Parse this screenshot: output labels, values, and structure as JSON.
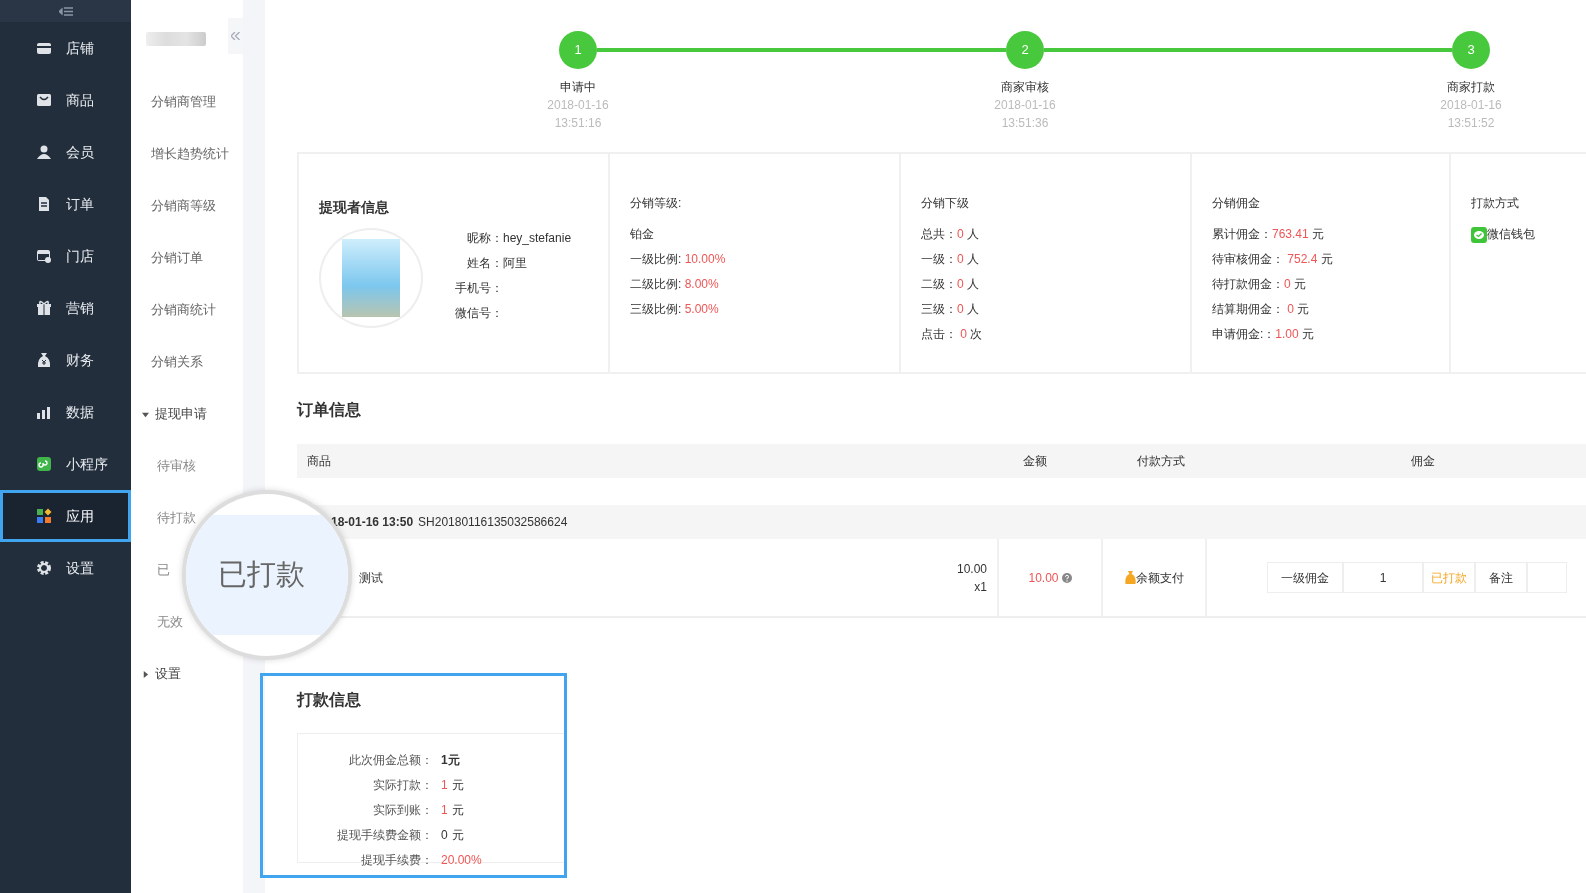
{
  "sidebar": {
    "items": [
      {
        "label": "店铺",
        "selected": false
      },
      {
        "label": "商品",
        "selected": false
      },
      {
        "label": "会员",
        "selected": false
      },
      {
        "label": "订单",
        "selected": false
      },
      {
        "label": "门店",
        "selected": false
      },
      {
        "label": "营销",
        "selected": false
      },
      {
        "label": "财务",
        "selected": false
      },
      {
        "label": "数据",
        "selected": false
      },
      {
        "label": "小程序",
        "selected": false
      },
      {
        "label": "应用",
        "selected": true
      },
      {
        "label": "设置",
        "selected": false
      }
    ]
  },
  "subnav": {
    "items": [
      {
        "label": "分销商管理"
      },
      {
        "label": "增长趋势统计"
      },
      {
        "label": "分销商等级"
      },
      {
        "label": "分销订单"
      },
      {
        "label": "分销商统计"
      },
      {
        "label": "分销关系"
      },
      {
        "label": "提现申请",
        "expanded": true,
        "children": [
          {
            "label": "待审核"
          },
          {
            "label": "待打款"
          },
          {
            "label": "已"
          },
          {
            "label": "无效"
          }
        ]
      },
      {
        "label": "设置",
        "expanded": false
      }
    ]
  },
  "steps": [
    {
      "number": "1",
      "label": "申请中",
      "date": "2018-01-16",
      "time": "13:51:16",
      "done": true
    },
    {
      "number": "2",
      "label": "商家审核",
      "date": "2018-01-16",
      "time": "13:51:36",
      "done": true
    },
    {
      "number": "3",
      "label": "商家打款",
      "date": "2018-01-16",
      "time": "13:51:52",
      "done": true
    }
  ],
  "withdrawer": {
    "title": "提现者信息",
    "fields": [
      {
        "label": "昵称：",
        "value": "hey_stefanie"
      },
      {
        "label": "姓名：",
        "value": "阿里"
      },
      {
        "label": "手机号："
      },
      {
        "label": "微信号："
      }
    ]
  },
  "level": {
    "title": "分销等级:",
    "name": "铂金",
    "rows": [
      {
        "label": "一级比例: ",
        "value": "10.00%"
      },
      {
        "label": "二级比例: ",
        "value": "8.00%"
      },
      {
        "label": "三级比例: ",
        "value": "5.00%"
      }
    ]
  },
  "subordinates": {
    "title": "分销下级",
    "rows": [
      {
        "label": "总共：",
        "value": "0",
        "unit": "人"
      },
      {
        "label": "一级：",
        "value": "0",
        "unit": "人"
      },
      {
        "label": "二级：",
        "value": "0",
        "unit": "人"
      },
      {
        "label": "三级：",
        "value": "0",
        "unit": "人"
      },
      {
        "label": "点击： ",
        "value": "0",
        "unit": "次"
      }
    ]
  },
  "commission": {
    "title": "分销佣金",
    "rows": [
      {
        "label": "累计佣金：",
        "value": "763.41",
        "unit": "元"
      },
      {
        "label": "待审核佣金： ",
        "value": "752.4",
        "unit": "元"
      },
      {
        "label": "待打款佣金：",
        "value": "0",
        "unit": "元"
      },
      {
        "label": "结算期佣金： ",
        "value": "0",
        "unit": "元"
      },
      {
        "label": "申请佣金:：",
        "value": "1.00",
        "unit": "元"
      }
    ]
  },
  "payment_method": {
    "title": "打款方式",
    "method": "微信钱包"
  },
  "order_info": {
    "title": "订单信息",
    "columns": [
      "商品",
      "金额",
      "付款方式",
      "佣金"
    ],
    "order": {
      "time": "18-01-16 13:50",
      "number": "SH20180116135032586624"
    },
    "item": {
      "name": "测试",
      "price": "10.00",
      "quantity": "x1",
      "amount": "10.00",
      "payment": "余额支付",
      "commission": [
        "一级佣金",
        "1",
        "已打款",
        "备注"
      ]
    }
  },
  "payout": {
    "title": "打款信息",
    "rows": [
      {
        "label": "此次佣金总额：",
        "value": "1元",
        "kind": "bold"
      },
      {
        "label": "实际打款：",
        "value": "1",
        "unit": "元",
        "kind": "red"
      },
      {
        "label": "实际到账：",
        "value": "1",
        "unit": "元",
        "kind": "red"
      },
      {
        "label": "提现手续费金额：",
        "value": "0",
        "unit": "元",
        "kind": "plain"
      },
      {
        "label": "提现手续费：",
        "value": "20.00%",
        "kind": "red"
      }
    ]
  },
  "magnifier": {
    "text": "已打款"
  }
}
